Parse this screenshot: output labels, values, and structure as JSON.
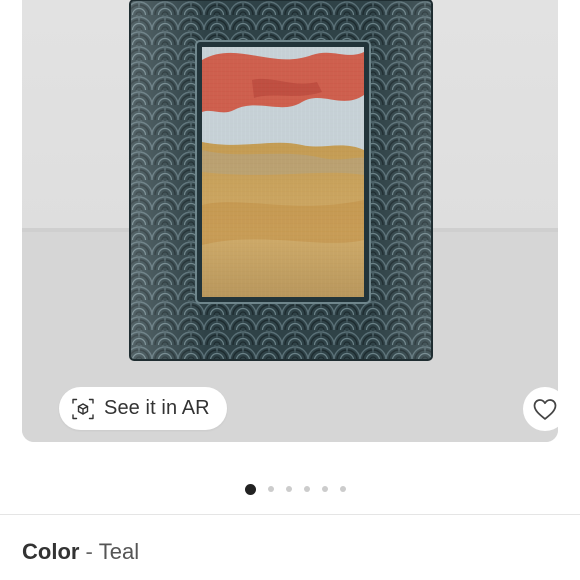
{
  "product_image": {
    "frame_color": "#2f4247",
    "ar_button": {
      "label": "See it in AR"
    },
    "favorite": {
      "icon": "heart-icon"
    }
  },
  "carousel": {
    "total": 6,
    "active_index": 0
  },
  "variant": {
    "label": "Color",
    "separator": "-",
    "value": "Teal"
  }
}
